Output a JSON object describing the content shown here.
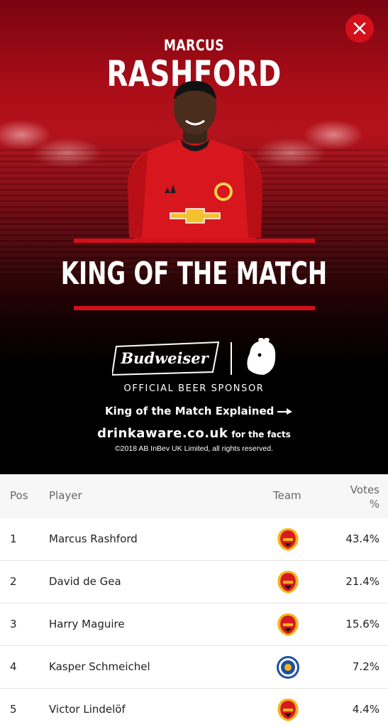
{
  "hero": {
    "first_name": "MARCUS",
    "last_name": "RASHFORD",
    "title": "KING OF THE MATCH",
    "sponsor_text": "OFFICIAL BEER SPONSOR",
    "explained_link": "King of the Match Explained",
    "drinkaware_domain": "drinkaware.co.uk",
    "drinkaware_suffix": "for the facts",
    "copyright": "©2018 AB InBev UK Limited, all rights reserved.",
    "accent_color": "#d4101d",
    "sponsor_brand": "Budweiser"
  },
  "table": {
    "headers": {
      "pos": "Pos",
      "player": "Player",
      "team": "Team",
      "votes_line1": "Votes",
      "votes_line2": "%"
    },
    "rows": [
      {
        "pos": "1",
        "player": "Marcus Rashford",
        "team_icon": "man-utd-crest-icon",
        "votes": "43.4%"
      },
      {
        "pos": "2",
        "player": "David de Gea",
        "team_icon": "man-utd-crest-icon",
        "votes": "21.4%"
      },
      {
        "pos": "3",
        "player": "Harry Maguire",
        "team_icon": "man-utd-crest-icon",
        "votes": "15.6%"
      },
      {
        "pos": "4",
        "player": "Kasper Schmeichel",
        "team_icon": "leicester-crest-icon",
        "votes": "7.2%"
      },
      {
        "pos": "5",
        "player": "Victor Lindelöf",
        "team_icon": "man-utd-crest-icon",
        "votes": "4.4%"
      }
    ]
  }
}
